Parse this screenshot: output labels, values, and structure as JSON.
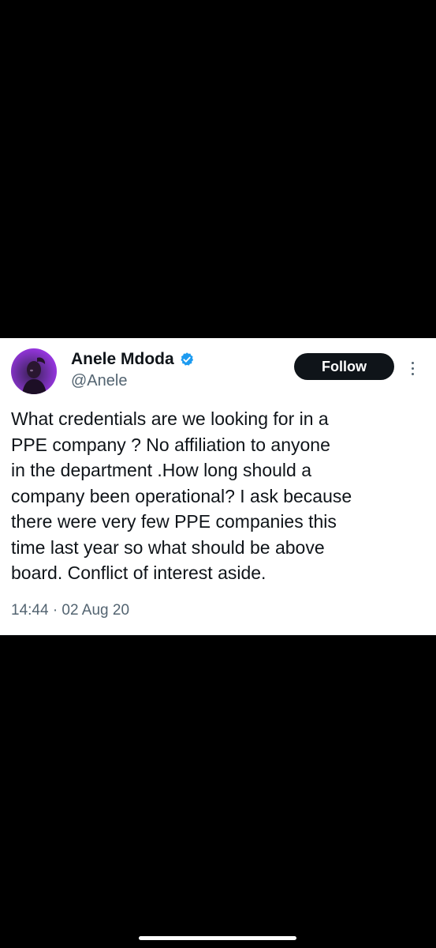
{
  "tweet": {
    "author": {
      "display_name": "Anele Mdoda",
      "handle": "@Anele",
      "verified": true,
      "verified_badge_color": "#1d9bf0"
    },
    "follow_label": "Follow",
    "text_lines": [
      "What credentials are we looking for in a",
      "PPE company ? No affiliation to anyone",
      "in the department .How long should a",
      "company been operational? I ask because",
      "there were very few PPE companies this",
      "time last year so what should be above",
      "board. Conflict of interest aside."
    ],
    "timestamp": "14:44 · 02 Aug 20"
  },
  "icons": {
    "verified": "verified-badge-icon",
    "more": "more-options-icon"
  },
  "colors": {
    "background": "#000000",
    "card": "#ffffff",
    "text": "#0f1419",
    "secondary_text": "#536471",
    "follow_button": "#0f1419"
  }
}
